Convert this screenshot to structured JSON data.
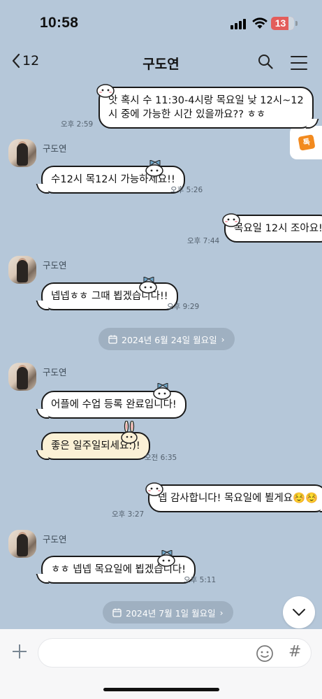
{
  "status_bar": {
    "time": "10:58",
    "battery": "13"
  },
  "nav": {
    "back_count": "12",
    "title": "구도연"
  },
  "messages": [
    {
      "side": "right",
      "text": "앗 혹시 수 11:30-4시랑 목요일 낮 12시~12시 중에 가능한 시간 있을까요?? ㅎㅎ",
      "time": "오후 2:59"
    },
    {
      "side": "left",
      "sender": "구도연",
      "text": "수12시 목12시 가능하세요!!",
      "time": "오후 5:26"
    },
    {
      "side": "right",
      "text": "목요일 12시 조아요!",
      "time": "오후 7:44"
    },
    {
      "side": "left",
      "sender": "구도연",
      "text": "넵넵ㅎㅎ 그때 뵙겠습니다!!",
      "time": "오후 9:29"
    },
    {
      "side": "left",
      "sender": "구도연",
      "text": "어플에 수업 등록 완료입니다!",
      "time": ""
    },
    {
      "side": "left",
      "text": "좋은 일주일되세요:)!",
      "time": "오전 6:35"
    },
    {
      "side": "right",
      "text": "넵 감사합니다! 목요일에 뵐게요☺️☺️",
      "time": "오후 3:27"
    },
    {
      "side": "left",
      "sender": "구도연",
      "text": "ㅎㅎ 넵넵 목요일에 뵙겠습니다!",
      "time": "오후 5:11"
    }
  ],
  "date_dividers": [
    "2024년 6월 24일 월요일",
    "2024년 7월 1일 월요일"
  ],
  "colors": {
    "background": "#b5c7d9",
    "bubble": "#ffffff",
    "bubble_yellow": "#fbf1d6",
    "battery": "#e35d5b",
    "side_button_accent": "#f28a1f"
  },
  "input": {
    "placeholder": ""
  },
  "side_button": {
    "label": "톡"
  },
  "icons": [
    "back-icon",
    "search-icon",
    "menu-icon",
    "calendar-icon",
    "chevron-right-icon",
    "chevron-down-icon",
    "plus-icon",
    "emoji-icon",
    "hash-icon"
  ]
}
